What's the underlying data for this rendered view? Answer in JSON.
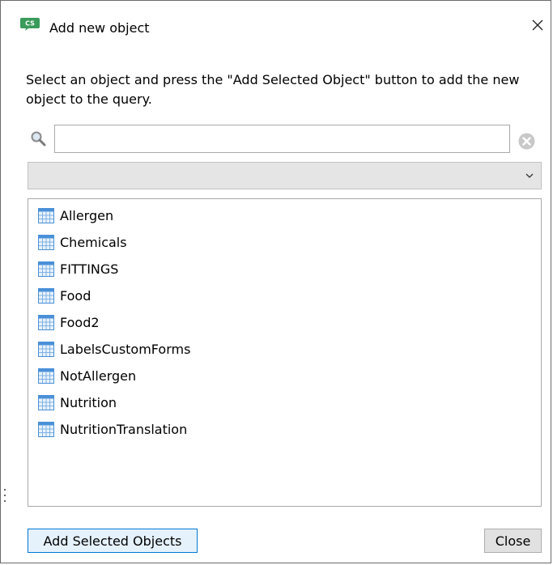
{
  "window": {
    "title": "Add new object",
    "app_icon_text": "CS"
  },
  "instructions": "Select an object and press the \"Add Selected Object\" button to add the new object to the query.",
  "search": {
    "value": "",
    "placeholder": ""
  },
  "filter_dropdown": {
    "selected": ""
  },
  "objects": [
    "Allergen",
    "Chemicals",
    "FITTINGS",
    "Food",
    "Food2",
    "LabelsCustomForms",
    "NotAllergen",
    "Nutrition",
    "NutritionTranslation"
  ],
  "buttons": {
    "add_label": "Add Selected Objects",
    "close_label": "Close"
  },
  "colors": {
    "app_icon": "#3a9b5a",
    "table_icon_header": "#4a90d9",
    "table_icon_body": "#e8f2fb",
    "accent": "#0078d7"
  }
}
